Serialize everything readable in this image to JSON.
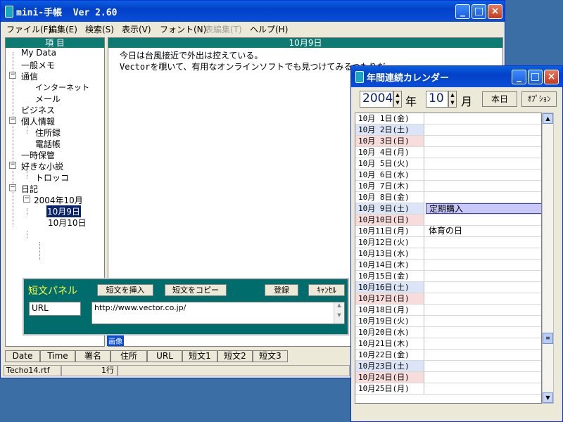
{
  "main_window": {
    "title": "mini-手帳  Ver 2.60",
    "menu": [
      "ファイル(F)",
      "編集(E)",
      "検索(S)",
      "表示(V)",
      "フォント(N)",
      "表編集(T)",
      "ヘルプ(H)"
    ],
    "tree": {
      "header": "項 目",
      "items": [
        {
          "label": "My Data"
        },
        {
          "label": "一般メモ"
        },
        {
          "label": "通信"
        },
        {
          "label": "インターネット"
        },
        {
          "label": "メール"
        },
        {
          "label": "ビジネス"
        },
        {
          "label": "個人情報"
        },
        {
          "label": "住所録"
        },
        {
          "label": "電話帳"
        },
        {
          "label": "一時保管"
        },
        {
          "label": "好きな小説"
        },
        {
          "label": "トロッコ"
        },
        {
          "label": "日記"
        },
        {
          "label": "2004年10月"
        },
        {
          "label": "10月9日"
        },
        {
          "label": "10月10日"
        }
      ]
    },
    "document": {
      "header": "10月9日",
      "lines": [
        "今日は台風接近で外出は控えている。",
        "Vectorを覗いて、有用なオンラインソフトでも見つけてみるつもりだ"
      ]
    },
    "short_panel": {
      "title": "短文パネル",
      "insert_button": "短文を挿入",
      "copy_button": "短文をコピー",
      "register_button": "登録",
      "cancel_button": "ｷｬﾝｾﾙ",
      "name_field": "URL",
      "text_field": "http://www.vector.co.jp/",
      "hidden_tab": "画像"
    },
    "tabs": [
      "Date",
      "Time",
      "署名",
      "住所",
      "URL",
      "短文1",
      "短文2",
      "短文3"
    ],
    "status": {
      "file": "Techo14.rtf",
      "line": "1行"
    }
  },
  "calendar_window": {
    "title": "年間連続カレンダー",
    "year": "2004",
    "year_label": "年",
    "month": "10",
    "month_label": "月",
    "today_button": "本日",
    "option_button": "ｵﾌﾟｼｮﾝ",
    "rows": [
      {
        "date": "10月 1日(金)",
        "note": "",
        "type": "weekday"
      },
      {
        "date": "10月 2日(土)",
        "note": "",
        "type": "sat"
      },
      {
        "date": "10月 3日(日)",
        "note": "",
        "type": "sun"
      },
      {
        "date": "10月 4日(月)",
        "note": "",
        "type": "weekday"
      },
      {
        "date": "10月 5日(火)",
        "note": "",
        "type": "weekday"
      },
      {
        "date": "10月 6日(水)",
        "note": "",
        "type": "weekday"
      },
      {
        "date": "10月 7日(木)",
        "note": "",
        "type": "weekday"
      },
      {
        "date": "10月 8日(金)",
        "note": "",
        "type": "weekday"
      },
      {
        "date": "10月 9日(土)",
        "note": "定期購入",
        "type": "sat",
        "selected": true
      },
      {
        "date": "10月10日(日)",
        "note": "",
        "type": "sun"
      },
      {
        "date": "10月11日(月)",
        "note": "体育の日",
        "type": "weekday"
      },
      {
        "date": "10月12日(火)",
        "note": "",
        "type": "weekday"
      },
      {
        "date": "10月13日(水)",
        "note": "",
        "type": "weekday"
      },
      {
        "date": "10月14日(木)",
        "note": "",
        "type": "weekday"
      },
      {
        "date": "10月15日(金)",
        "note": "",
        "type": "weekday"
      },
      {
        "date": "10月16日(土)",
        "note": "",
        "type": "sat"
      },
      {
        "date": "10月17日(日)",
        "note": "",
        "type": "sun"
      },
      {
        "date": "10月18日(月)",
        "note": "",
        "type": "weekday"
      },
      {
        "date": "10月19日(火)",
        "note": "",
        "type": "weekday"
      },
      {
        "date": "10月20日(水)",
        "note": "",
        "type": "weekday"
      },
      {
        "date": "10月21日(木)",
        "note": "",
        "type": "weekday"
      },
      {
        "date": "10月22日(金)",
        "note": "",
        "type": "weekday"
      },
      {
        "date": "10月23日(土)",
        "note": "",
        "type": "sat"
      },
      {
        "date": "10月24日(日)",
        "note": "",
        "type": "sun"
      },
      {
        "date": "10月25日(月)",
        "note": "",
        "type": "weekday"
      }
    ]
  },
  "colors": {
    "panel_header": "#0e7b73",
    "short_panel_bg": "#006c6c",
    "selection": "#0a246a",
    "saturday": "#dce4f8",
    "sunday": "#f8dcdc"
  }
}
